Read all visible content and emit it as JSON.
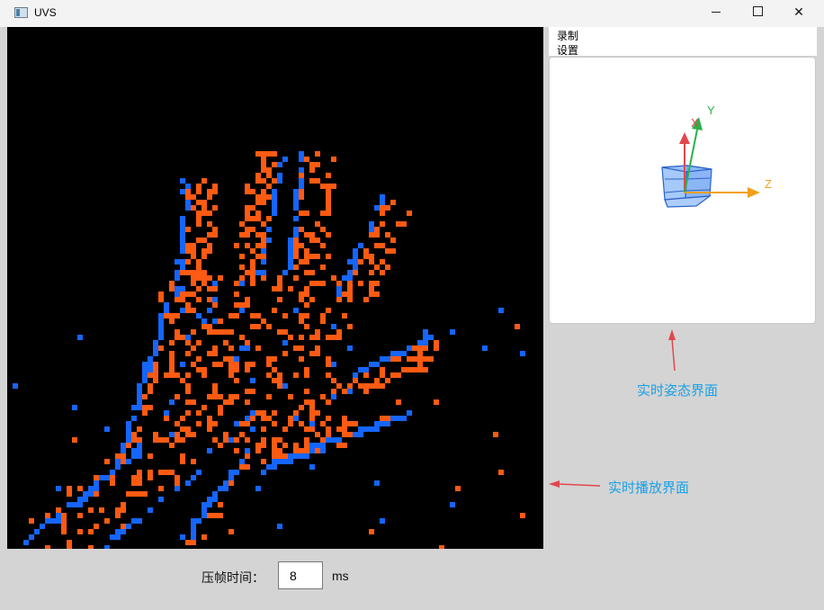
{
  "window": {
    "title": "UVS",
    "minimize_icon": "window-minimize-icon",
    "maximize_icon": "window-maximize-icon",
    "close_glyph": "✕"
  },
  "menu": {
    "items": [
      {
        "label": "录制"
      },
      {
        "label": "设置"
      }
    ]
  },
  "pose_view": {
    "axes": {
      "x": "X",
      "y": "Y",
      "z": "Z"
    },
    "colors": {
      "x": "#e0474c",
      "y": "#2bb14b",
      "z": "#f2a019",
      "cube": "#5b9cf6"
    }
  },
  "event_view": {
    "colors": {
      "positive": "#ff5a12",
      "negative": "#1565ff",
      "background": "#000000"
    }
  },
  "controls": {
    "frame_time_label": "压帧时间：",
    "frame_time_value": "8",
    "frame_time_unit": "ms"
  },
  "annotations": {
    "pose_label": "实时姿态界面",
    "playback_label": "实时播放界面",
    "color": "#1aa0e6",
    "arrow_color": "#e0474c"
  }
}
